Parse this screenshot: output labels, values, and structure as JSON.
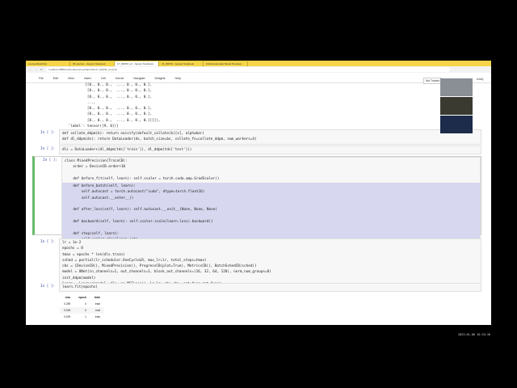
{
  "browser": {
    "tabs": [
      "course/22p2/nbs/",
      "05_learner - Jupyter Notebook",
      "17_DDPM_v2 - Jupyter Notebook",
      "15_DDPM - Jupyter Notebook",
      "CUDA Automatic Mixed Precision"
    ],
    "url": "localhost:8888/notebooks/course/22p2/nbs/17_DDPM_v2.ipynb"
  },
  "menu": [
    "File",
    "Edit",
    "View",
    "Insert",
    "Cell",
    "Kernel",
    "Navigate",
    "Widgets",
    "Help"
  ],
  "status": {
    "trusted": "Not Trusted",
    "kernel": "ernel)"
  },
  "output_top": "         [[0., 0., 0.,  ..., 0., 0., 0.],\n          [0., 0., 0.,  ..., 0., 0., 0.],\n          [0., 0., 0.,  ..., 0., 0., 0.],\n          ...,\n          [0., 0., 0.,  ..., 0., 0., 0.],\n          [0., 0., 0.,  ..., 0., 0., 0.],\n          [0., 0., 0.,  ..., 0., 0., 0.]]]]),\n 'label': tensor([9, 0])}",
  "cells": [
    {
      "prompt": "In [ ]:",
      "code": "def collate_ddpm(b): return noisify(default_collate(b)[x], alphabar)\ndef dl_ddpm(ds): return DataLoader(ds, batch_size=bs, collate_fn=collate_ddpm, num_workers=4)"
    },
    {
      "prompt": "In [ ]:",
      "code": "dls = DataLoaders(dl_ddpm(tds['train']), dl_ddpm(tds['test']))"
    },
    {
      "prompt": "In [ ]:",
      "code_a": "class MixedPrecision(TrainCB):\n    order = DeviceCB.order+10\n\n    def before_fit(self, learn): self.scaler = torch.cuda.amp.GradScaler()\n",
      "code_b": "    def before_batch(self, learn):\n        self.autocast = torch.autocast(\"cuda\", dtype=torch.float16)\n        self.autocast.__enter__()\n\n    def after_loss(self, learn): self.autocast.__exit__(None, None, None)\n\n    def backward(self, learn): self.scaler.scale(learn.loss).backward()\n\n    def step(self, learn):\n        self.scaler.step(learn.opt)\n        self.scaler.update()"
    },
    {
      "prompt": "In [ ]:",
      "code": "lr = 1e-2\nepochs = 8\ntmax = epochs * len(dls.train)\nsched = partial(lr_scheduler.OneCycleLR, max_lr=lr, total_steps=tmax)\ncbs = [DeviceCB(), MixedPrecision(), ProgressCB(plot=True), MetricsCB(), BatchSchedCB(sched)]\nmodel = UNet(in_channels=1, out_channels=1, block_out_channels=(16, 32, 64, 128), norm_num_groups=8)\ninit_ddpm(model)\nlearn = Learner(model, dls, nn.MSELoss(), lr=lr, cbs=cbs, opt_func=opt_func)"
    },
    {
      "prompt": "In [ ]:",
      "code": "learn.fit(epochs)"
    }
  ],
  "table": {
    "headers": [
      "loss",
      "epoch",
      "train"
    ],
    "rows": [
      [
        "0.259",
        "0",
        "train"
      ],
      [
        "0.029",
        "0",
        "eval"
      ],
      [
        "0.029",
        "1",
        "train"
      ]
    ]
  },
  "timestamp": "2023-01-06 16:33:16"
}
